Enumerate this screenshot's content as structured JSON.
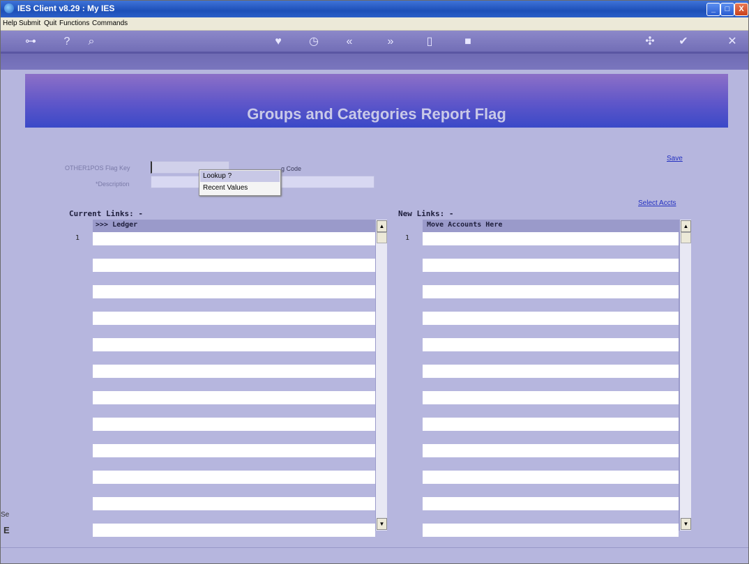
{
  "window": {
    "title": "IES Client v8.29 : My IES",
    "minimize": "_",
    "maximize": "□",
    "close": "X"
  },
  "menu": [
    "Help",
    "Submit",
    "Quit",
    "Functions",
    "Commands"
  ],
  "toolbar": {
    "icons": [
      "key-icon",
      "help-icon",
      "search-icon",
      "heart-icon",
      "clock-icon",
      "back-icon",
      "forward-icon",
      "print-icon",
      "stop-icon",
      "refresh-icon",
      "ok-icon",
      "close-icon"
    ]
  },
  "page": {
    "title": "Groups and Categories Report Flag"
  },
  "form": {
    "flag_key_label": "OTHER1POS Flag Key",
    "flag_key_value": "",
    "grouping_code_label": "g Code",
    "description_label": "*Description",
    "description_value": ""
  },
  "popup": {
    "items": [
      "Lookup ?",
      "Recent Values"
    ]
  },
  "links": {
    "save": "Save",
    "select_accts": "Select Accts"
  },
  "current_links": {
    "title": "Current Links: -",
    "column_header": ">>> Ledger",
    "row_number": "1"
  },
  "new_links": {
    "title": "New Links: -",
    "column_header": "Move Accounts Here",
    "row_number": "1"
  },
  "status": {
    "left_text": "Se",
    "left_glyph": "E"
  },
  "scroll": {
    "up": "▲",
    "down": "▼"
  }
}
